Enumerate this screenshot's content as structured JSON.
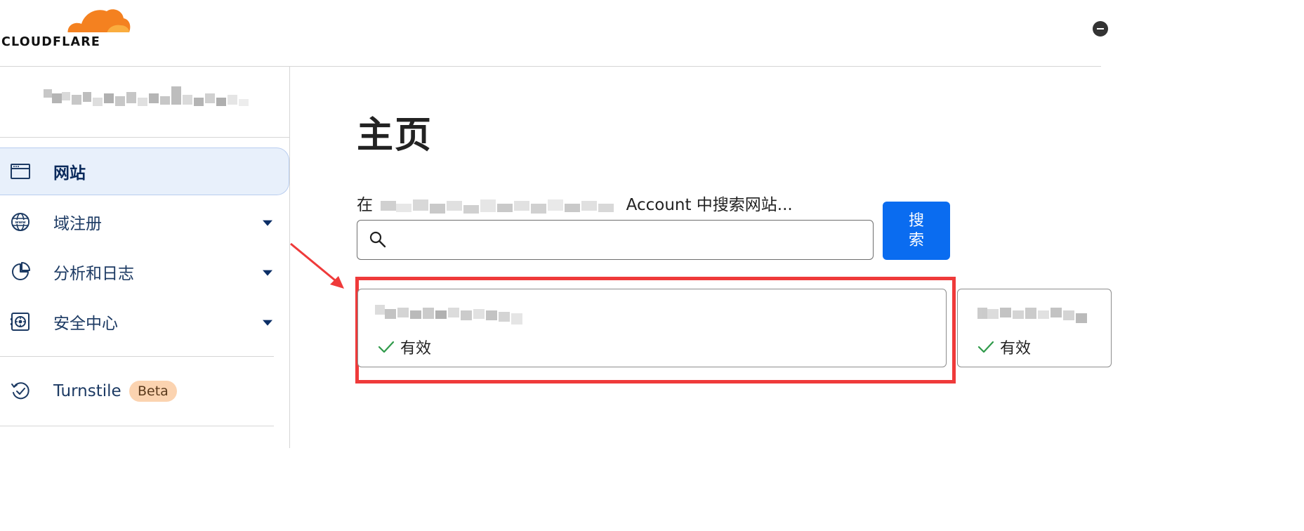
{
  "header": {
    "logo_text": "CLOUDFLARE",
    "logo_colors": {
      "cloud_main": "#f48120",
      "cloud_light": "#faad3f"
    }
  },
  "sidebar": {
    "account_name": "",
    "items": [
      {
        "label": "网站",
        "icon": "browser-window-icon",
        "active": true
      },
      {
        "label": "域注册",
        "icon": "globe-www-icon",
        "has_caret": true
      },
      {
        "label": "分析和日志",
        "icon": "pie-chart-icon",
        "has_caret": true
      },
      {
        "label": "安全中心",
        "icon": "safe-vault-icon",
        "has_caret": true
      },
      {
        "label": "Turnstile",
        "icon": "refresh-check-icon",
        "badge": "Beta"
      }
    ]
  },
  "main": {
    "title": "主页",
    "search": {
      "label_prefix": "在",
      "label_suffix": "Account 中搜索网站...",
      "value": "",
      "placeholder": "",
      "button_label": "搜索"
    },
    "sites": [
      {
        "name": "",
        "status": "有效"
      },
      {
        "name": "",
        "status": "有效"
      }
    ]
  },
  "colors": {
    "accent_blue": "#0a6cf0",
    "nav_active_bg": "#e8f0fb",
    "highlight_red": "#ef3a3a",
    "status_green": "#2f9a4a",
    "beta_badge_bg": "#fbd3b0"
  }
}
